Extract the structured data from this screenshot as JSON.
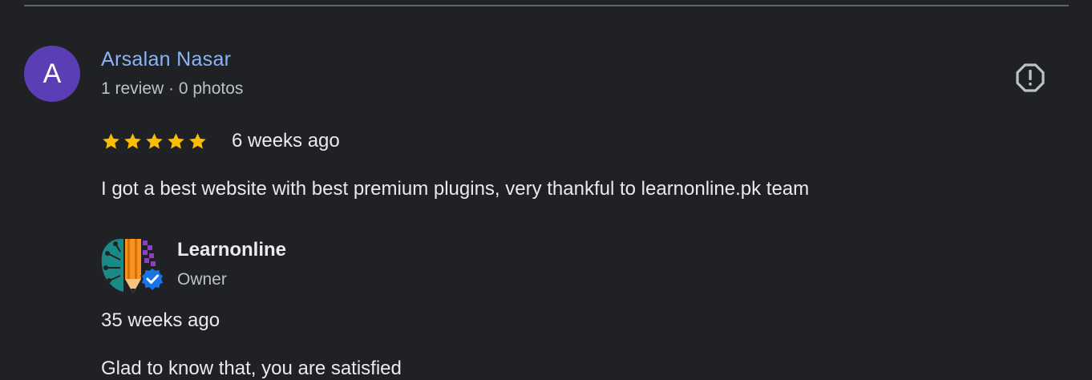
{
  "review": {
    "avatar_letter": "A",
    "reviewer_name": "Arsalan Nasar",
    "reviewer_stats": "1 review · 0 photos",
    "rating": 5,
    "rating_max": 5,
    "time": "6 weeks ago",
    "text": "I got a best website with best premium plugins, very thankful to learnonline.pk team"
  },
  "owner_reply": {
    "name": "Learnonline",
    "role": "Owner",
    "time": "35 weeks ago",
    "text": "Glad to know that, you are satisfied"
  },
  "icons": {
    "report": "report-flag-icon",
    "star": "star-icon",
    "verified": "verified-badge-icon"
  },
  "colors": {
    "background": "#202124",
    "avatar": "#5b3eb5",
    "link": "#8ab4f8",
    "star": "#fbbc04",
    "verified": "#1a73e8"
  }
}
